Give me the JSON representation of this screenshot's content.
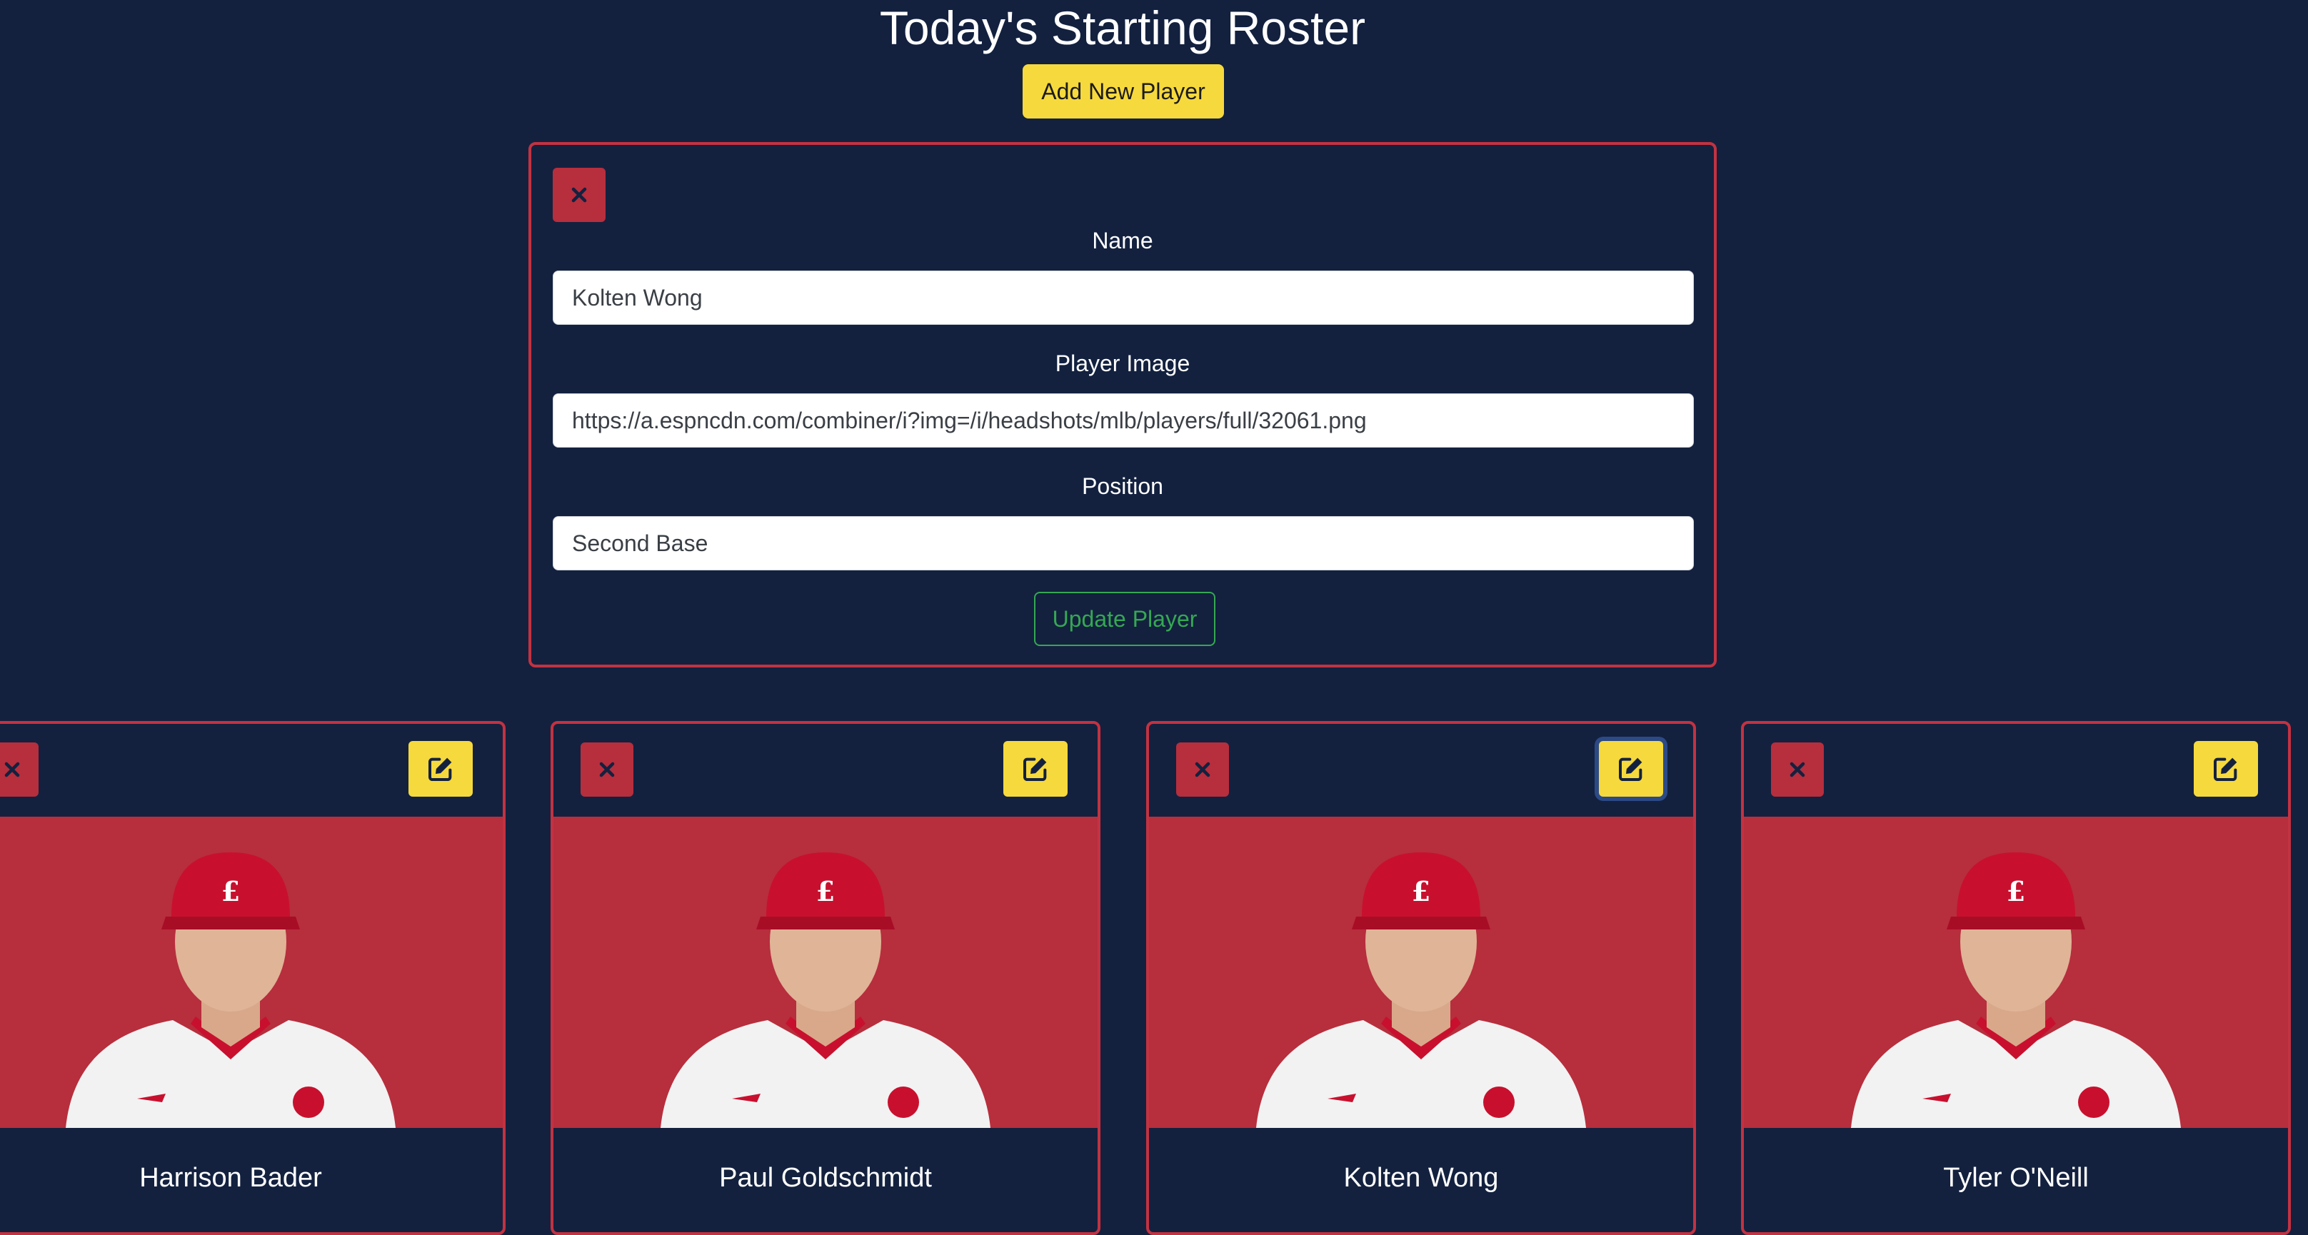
{
  "header": {
    "title": "Today's Starting Roster",
    "add_button_label": "Add New Player"
  },
  "form": {
    "name_label": "Name",
    "name_value": "Kolten Wong",
    "image_label": "Player Image",
    "image_value": "https://a.espncdn.com/combiner/i?img=/i/headshots/mlb/players/full/32061.png",
    "position_label": "Position",
    "position_value": "Second Base",
    "update_button_label": "Update Player"
  },
  "players": [
    {
      "name": "Harrison Bader",
      "photo": "player-headshot",
      "focused_edit": false
    },
    {
      "name": "Paul Goldschmidt",
      "photo": "player-headshot",
      "focused_edit": false
    },
    {
      "name": "Kolten Wong",
      "photo": "player-headshot",
      "focused_edit": true
    },
    {
      "name": "Tyler O'Neill",
      "photo": "player-headshot",
      "focused_edit": false
    }
  ],
  "icons": {
    "close": "close-icon",
    "edit": "edit-icon"
  },
  "colors": {
    "background": "#13213f",
    "accent_yellow": "#f6d93c",
    "card_red": "#b72e3d",
    "border_red": "#c33241",
    "success_green": "#35a852"
  }
}
